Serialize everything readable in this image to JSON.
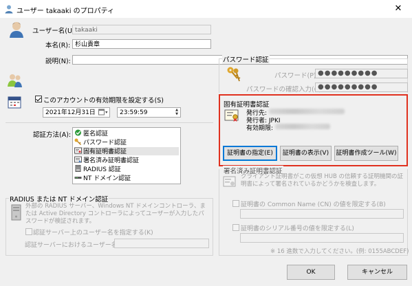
{
  "window": {
    "title": "ユーザー takaaki のプロパティ",
    "close_label": "✕"
  },
  "user": {
    "username_label": "ユーザー名(U):",
    "username_value": "takaaki",
    "realname_label": "本名(R):",
    "realname_value": "杉山貴章",
    "desc_label": "説明(N):",
    "desc_value": ""
  },
  "expiry": {
    "checkbox_label": "このアカウントの有効期限を設定する(S)",
    "date_value": "2021年12月31日",
    "time_value": "23:59:59"
  },
  "auth": {
    "label": "認証方法(A):",
    "items": [
      "匿名認証",
      "パスワード認証",
      "固有証明書認証",
      "署名済み証明書認証",
      "RADIUS 認証",
      "NT ドメイン認証"
    ]
  },
  "radius": {
    "title": "RADIUS または NT ドメイン認証",
    "desc": "外部の RADIUS サーバー、Windows NT ドメインコントローラ、または Active Directory コントローラによってユーザーが入力したパスワードが検証されます。",
    "check_label": "認証サーバー上のユーザー名を指定する(K)",
    "name_label": "認証サーバーにおけるユーザー名(T):"
  },
  "password": {
    "title": "パスワード認証",
    "pwd_label": "パスワード(P):",
    "pwd_value": "●●●●●●●●●",
    "confirm_label": "パスワードの確認入力(C):",
    "confirm_value": "●●●●●●●●●"
  },
  "cert": {
    "title": "固有証明書認証",
    "issued_to_label": "発行先:",
    "issuer_label": "発行者: JPKI",
    "expires_label": "有効期限:",
    "btn_specify": "証明書の指定(E)",
    "btn_view": "証明書の表示(V)",
    "btn_tool": "証明書作成ツール(W)"
  },
  "signed": {
    "title": "署名済み証明書認証",
    "desc": "クライアント証明書がこの仮想 HUB の信頼する証明機関の証明書によって署名されているかどうかを検査します。",
    "cn_label": "証明書の Common Name (CN) の値を限定する(B)",
    "serial_label": "証明書のシリアル番号の値を限定する(L)",
    "hint": "※ 16 進数で入力してください。(例: 0155ABCDEF)"
  },
  "footer": {
    "ok": "OK",
    "cancel": "キャンセル"
  },
  "colors": {
    "highlight": "#e0301e",
    "focus": "#0078d7"
  }
}
